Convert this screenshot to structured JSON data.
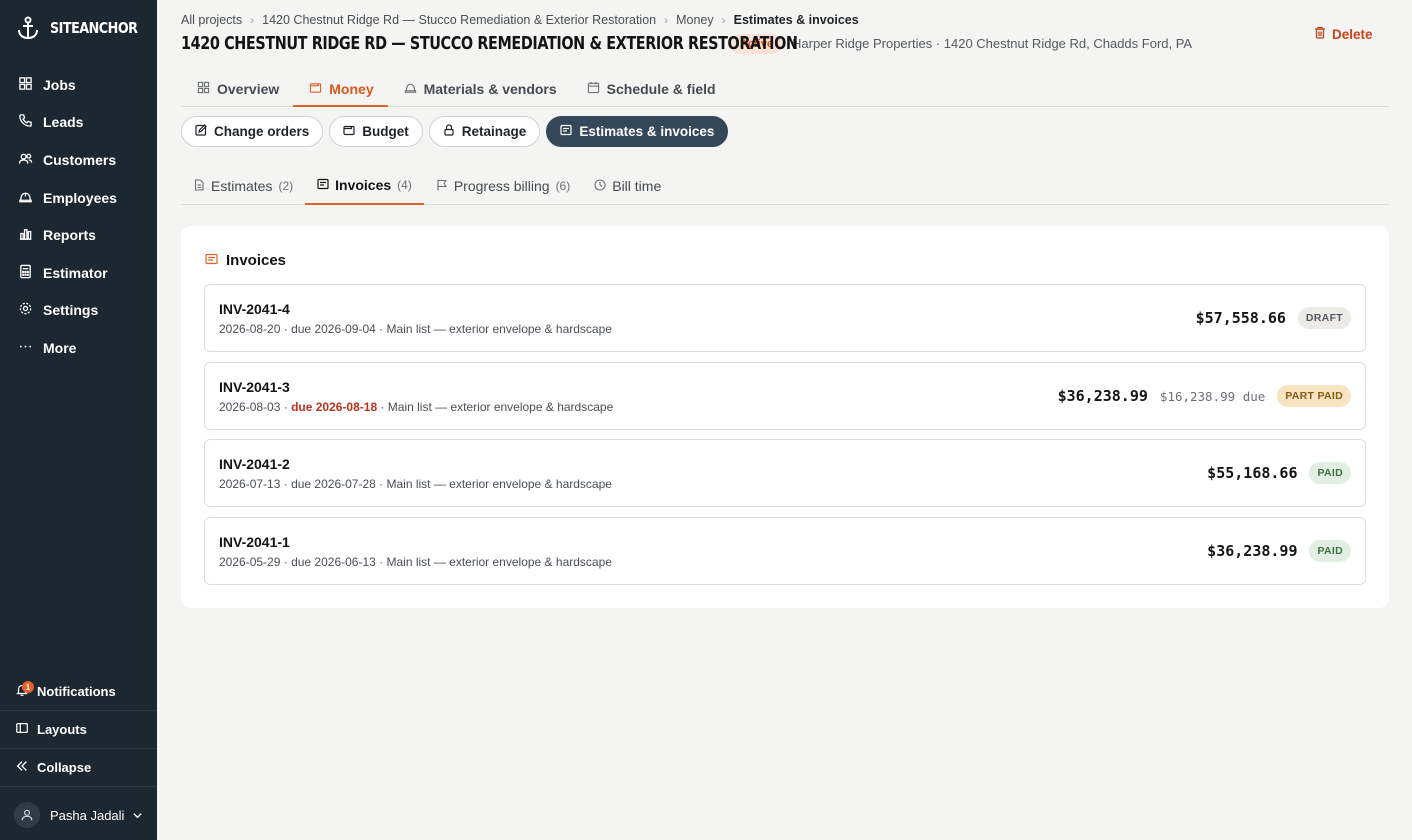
{
  "app": {
    "name": "SITEANCHOR"
  },
  "sidebar": {
    "items": [
      {
        "label": "Jobs",
        "icon": "grid-icon"
      },
      {
        "label": "Leads",
        "icon": "phone-icon"
      },
      {
        "label": "Customers",
        "icon": "users-icon"
      },
      {
        "label": "Employees",
        "icon": "hardhat-icon"
      },
      {
        "label": "Reports",
        "icon": "bar-chart-icon"
      },
      {
        "label": "Estimator",
        "icon": "calculator-icon"
      },
      {
        "label": "Settings",
        "icon": "gear-icon"
      },
      {
        "label": "More",
        "icon": "ellipsis-icon"
      }
    ],
    "notifications": {
      "label": "Notifications",
      "count": "1"
    },
    "layouts": "Layouts",
    "collapse": "Collapse",
    "user": "Pasha Jadali"
  },
  "breadcrumb": [
    "All projects",
    "1420 Chestnut Ridge Rd — Stucco Remediation & Exterior Restoration",
    "Money",
    "Estimates & invoices"
  ],
  "header": {
    "title": "1420 CHESTNUT RIDGE RD — STUCCO REMEDIATION & EXTERIOR RESTORATION",
    "status": "Active",
    "subtitle": "Harper Ridge Properties · 1420 Chestnut Ridge Rd, Chadds Ford, PA",
    "delete": "Delete"
  },
  "tabs": [
    {
      "label": "Overview",
      "icon": "grid-icon"
    },
    {
      "label": "Money",
      "icon": "wallet-icon",
      "active": true
    },
    {
      "label": "Materials & vendors",
      "icon": "hardhat-icon"
    },
    {
      "label": "Schedule & field",
      "icon": "calendar-icon"
    }
  ],
  "pills": [
    {
      "label": "Change orders",
      "icon": "edit-icon"
    },
    {
      "label": "Budget",
      "icon": "wallet-icon"
    },
    {
      "label": "Retainage",
      "icon": "lock-icon"
    },
    {
      "label": "Estimates & invoices",
      "icon": "receipt-icon",
      "active": true
    }
  ],
  "subtabs": [
    {
      "label": "Estimates",
      "count": "(2)",
      "icon": "document-icon"
    },
    {
      "label": "Invoices",
      "count": "(4)",
      "icon": "receipt-icon",
      "active": true
    },
    {
      "label": "Progress billing",
      "count": "(6)",
      "icon": "flag-icon"
    },
    {
      "label": "Bill time",
      "count": "",
      "icon": "clock-icon"
    }
  ],
  "invoices_section": {
    "title": "Invoices",
    "rows": [
      {
        "number": "INV-2041-4",
        "date": "2026-08-20",
        "due": "due 2026-09-04",
        "overdue": false,
        "list": "Main list — exterior envelope & hardscape",
        "amount": "$57,558.66",
        "remaining": "",
        "status": "DRAFT",
        "status_kind": "draft"
      },
      {
        "number": "INV-2041-3",
        "date": "2026-08-03",
        "due": "due 2026-08-18",
        "overdue": true,
        "list": "Main list — exterior envelope & hardscape",
        "amount": "$36,238.99",
        "remaining": "$16,238.99 due",
        "status": "PART PAID",
        "status_kind": "part"
      },
      {
        "number": "INV-2041-2",
        "date": "2026-07-13",
        "due": "due 2026-07-28",
        "overdue": false,
        "list": "Main list — exterior envelope & hardscape",
        "amount": "$55,168.66",
        "remaining": "",
        "status": "PAID",
        "status_kind": "paid"
      },
      {
        "number": "INV-2041-1",
        "date": "2026-05-29",
        "due": "due 2026-06-13",
        "overdue": false,
        "list": "Main list — exterior envelope & hardscape",
        "amount": "$36,238.99",
        "remaining": "",
        "status": "PAID",
        "status_kind": "paid"
      }
    ]
  }
}
